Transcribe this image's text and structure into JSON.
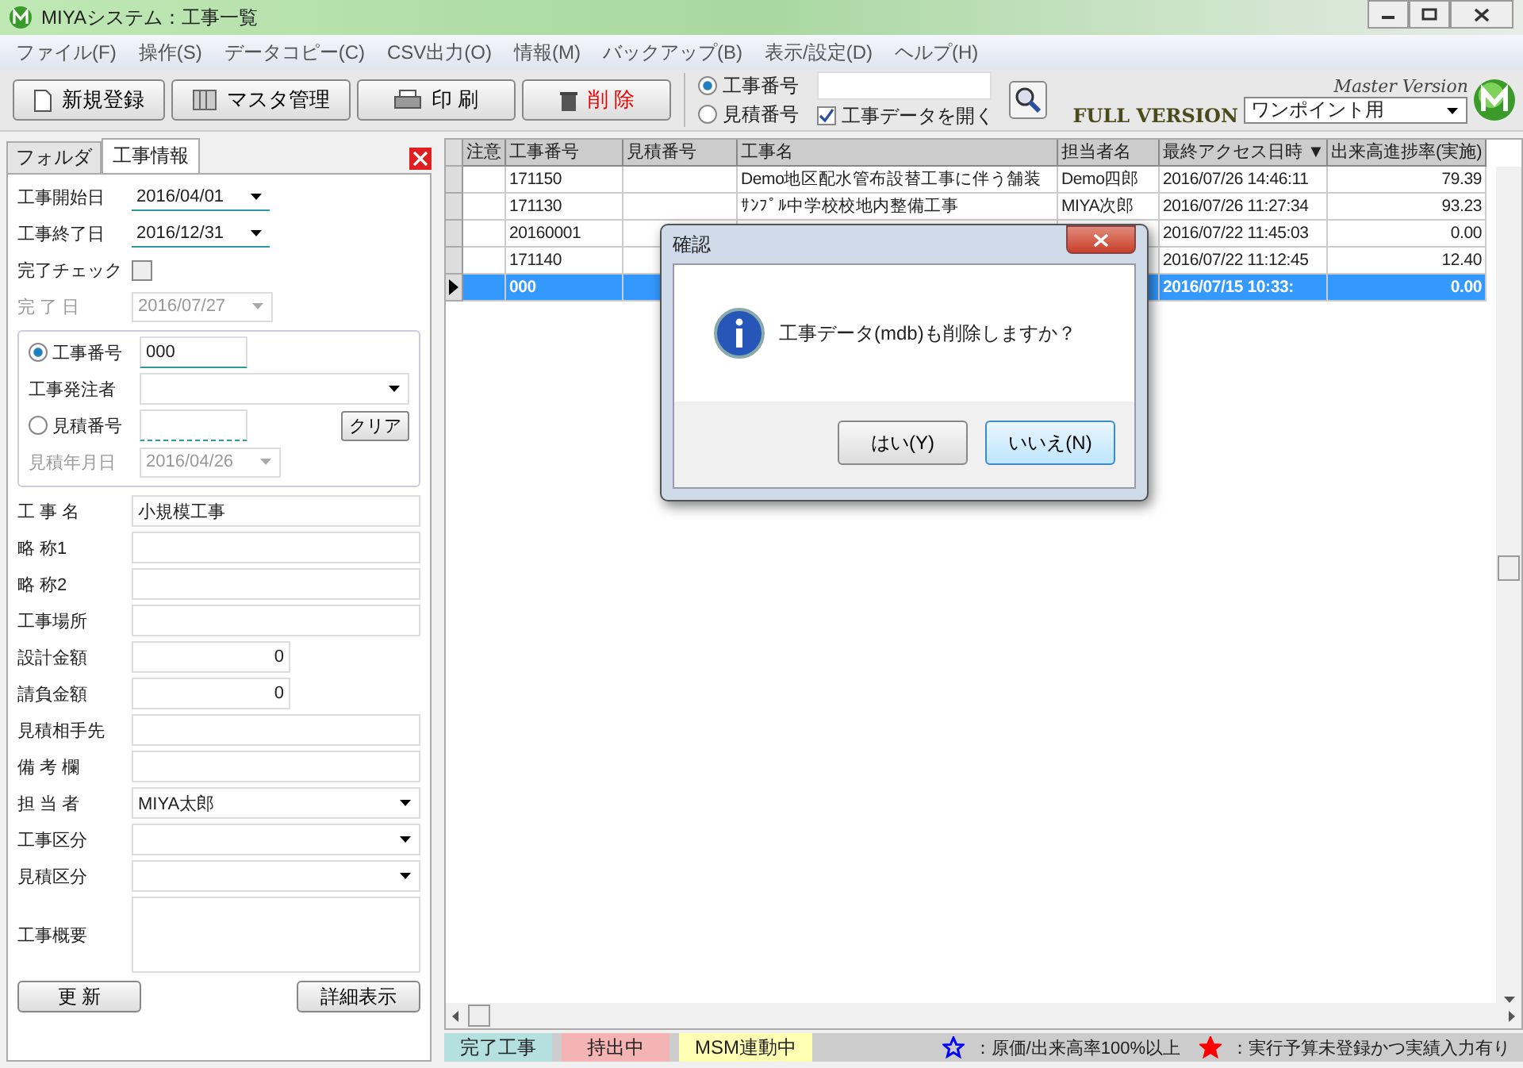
{
  "window": {
    "title": "MIYAシステム：工事一覧"
  },
  "menu": [
    "ファイル(F)",
    "操作(S)",
    "データコピー(C)",
    "CSV出力(O)",
    "情報(M)",
    "バックアップ(B)",
    "表示/設定(D)",
    "ヘルプ(H)"
  ],
  "toolbar": {
    "buttons": [
      {
        "label": "新規登録",
        "kind": "new"
      },
      {
        "label": "マスタ管理",
        "kind": "master"
      },
      {
        "label": "印 刷",
        "kind": "print"
      },
      {
        "label": "削 除",
        "kind": "delete"
      }
    ],
    "search_mode": [
      {
        "label": "工事番号",
        "selected": true
      },
      {
        "label": "見積番号",
        "selected": false
      }
    ],
    "open_data": {
      "label": "工事データを開く",
      "checked": true
    },
    "edition": "FULL VERSION",
    "master": "Master Version",
    "mode_select": "ワンポイント用"
  },
  "left_tabs": [
    {
      "label": "フォルダ",
      "selected": false
    },
    {
      "label": "工事情報",
      "selected": true
    }
  ],
  "top_fields": [
    {
      "label": "工事開始日",
      "kind": "date",
      "value": "2016/04/01",
      "disabled": false
    },
    {
      "label": "工事終了日",
      "kind": "date",
      "value": "2016/12/31",
      "disabled": false
    },
    {
      "label": "完了チェック",
      "kind": "check",
      "checked": false
    },
    {
      "label": "完 了 日",
      "kind": "date",
      "value": "2016/07/27",
      "disabled": true
    }
  ],
  "group": {
    "number": {
      "label": "工事番号",
      "selected": true,
      "value": "000"
    },
    "orderer": {
      "label": "工事発注者"
    },
    "estimate": {
      "label": "見積番号",
      "selected": false
    },
    "clear_button": "クリア",
    "estimate_date": {
      "label": "見積年月日",
      "value": "2016/04/26",
      "disabled": true
    }
  },
  "fields": [
    {
      "label": "工 事 名",
      "kind": "text",
      "value": "小規模工事"
    },
    {
      "label": "略 称1",
      "kind": "text"
    },
    {
      "label": "略 称2",
      "kind": "text"
    },
    {
      "label": "工事場所",
      "kind": "text"
    },
    {
      "label": "設計金額",
      "kind": "number",
      "value": "0"
    },
    {
      "label": "請負金額",
      "kind": "number",
      "value": "0"
    },
    {
      "label": "見積相手先",
      "kind": "text"
    },
    {
      "label": "備 考 欄",
      "kind": "text"
    },
    {
      "label": "担 当 者",
      "kind": "select",
      "value": "MIYA太郎"
    },
    {
      "label": "工事区分",
      "kind": "select"
    },
    {
      "label": "見積区分",
      "kind": "select"
    },
    {
      "label": "工事概要",
      "kind": "textarea"
    }
  ],
  "left_buttons": [
    "更 新",
    "詳細表示"
  ],
  "table": {
    "columns": [
      "注意",
      "工事番号",
      "見積番号",
      "工事名",
      "担当者名",
      "最終アクセス日時 ▼",
      "出来高進捗率(実施)"
    ],
    "rows": [
      {
        "selected": false,
        "number": "171150",
        "name": "Demo地区配水管布設替工事に伴う舗装",
        "person": "Demo四郎",
        "accessed": "2016/07/26 14:46:11",
        "progress": "79.39"
      },
      {
        "selected": false,
        "number": "171130",
        "name": "ｻﾝﾌﾟﾙ中学校校地内整備工事",
        "person": "MIYA次郎",
        "accessed": "2016/07/26 11:27:34",
        "progress": "93.23"
      },
      {
        "selected": false,
        "number": "20160001",
        "accessed": "2016/07/22 11:45:03",
        "progress": "0.00"
      },
      {
        "selected": false,
        "number": "171140",
        "accessed": "2016/07/22 11:12:45",
        "progress": "12.40"
      },
      {
        "selected": true,
        "number": "000",
        "accessed": "2016/07/15 10:33:",
        "progress": "0.00"
      }
    ]
  },
  "legend": [
    {
      "label": "完了工事",
      "color": "#b4e0e0"
    },
    {
      "label": "持出中",
      "color": "#f4b4b4"
    },
    {
      "label": "MSM連動中",
      "color": "#ffffb4"
    }
  ],
  "notes": [
    {
      "kind": "outline",
      "text": "：原価/出来高率100%以上",
      "color": "#0000ff"
    },
    {
      "kind": "solid",
      "text": "：実行予算未登録かつ実績入力有り",
      "color": "#ff0000"
    }
  ],
  "dialog": {
    "title": "確認",
    "message": "工事データ(mdb)も削除しますか？",
    "buttons": [
      {
        "label": "はい(Y)",
        "selected": false
      },
      {
        "label": "いいえ(N)",
        "selected": true
      }
    ]
  }
}
